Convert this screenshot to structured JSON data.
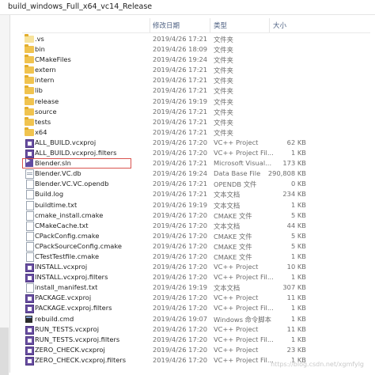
{
  "window": {
    "path": "build_windows_Full_x64_vc14_Release"
  },
  "columns": {
    "name": "",
    "date": "修改日期",
    "type": "类型",
    "size": "大小"
  },
  "files": [
    {
      "name": ".vs",
      "date": "2019/4/26 17:21",
      "type": "文件夹",
      "size": "",
      "icon": "folder-light-icon"
    },
    {
      "name": "bin",
      "date": "2019/4/26 18:09",
      "type": "文件夹",
      "size": "",
      "icon": "folder-icon"
    },
    {
      "name": "CMakeFiles",
      "date": "2019/4/26 19:24",
      "type": "文件夹",
      "size": "",
      "icon": "folder-icon"
    },
    {
      "name": "extern",
      "date": "2019/4/26 17:21",
      "type": "文件夹",
      "size": "",
      "icon": "folder-icon"
    },
    {
      "name": "intern",
      "date": "2019/4/26 17:21",
      "type": "文件夹",
      "size": "",
      "icon": "folder-icon"
    },
    {
      "name": "lib",
      "date": "2019/4/26 17:21",
      "type": "文件夹",
      "size": "",
      "icon": "folder-icon"
    },
    {
      "name": "release",
      "date": "2019/4/26 19:19",
      "type": "文件夹",
      "size": "",
      "icon": "folder-icon"
    },
    {
      "name": "source",
      "date": "2019/4/26 17:21",
      "type": "文件夹",
      "size": "",
      "icon": "folder-icon"
    },
    {
      "name": "tests",
      "date": "2019/4/26 17:21",
      "type": "文件夹",
      "size": "",
      "icon": "folder-icon"
    },
    {
      "name": "x64",
      "date": "2019/4/26 17:21",
      "type": "文件夹",
      "size": "",
      "icon": "folder-icon"
    },
    {
      "name": "ALL_BUILD.vcxproj",
      "date": "2019/4/26 17:20",
      "type": "VC++ Project",
      "size": "62 KB",
      "icon": "vcxproj-icon"
    },
    {
      "name": "ALL_BUILD.vcxproj.filters",
      "date": "2019/4/26 17:20",
      "type": "VC++ Project Fil...",
      "size": "1 KB",
      "icon": "vcxproj-icon"
    },
    {
      "name": "Blender.sln",
      "date": "2019/4/26 17:21",
      "type": "Microsoft Visual...",
      "size": "173 KB",
      "icon": "sln-icon",
      "selected": true
    },
    {
      "name": "Blender.VC.db",
      "date": "2019/4/26 19:24",
      "type": "Data Base File",
      "size": "290,808 KB",
      "icon": "db-icon"
    },
    {
      "name": "Blender.VC.VC.opendb",
      "date": "2019/4/26 17:21",
      "type": "OPENDB 文件",
      "size": "0 KB",
      "icon": "file-icon"
    },
    {
      "name": "Build.log",
      "date": "2019/4/26 17:21",
      "type": "文本文档",
      "size": "234 KB",
      "icon": "file-icon"
    },
    {
      "name": "buildtime.txt",
      "date": "2019/4/26 19:19",
      "type": "文本文档",
      "size": "1 KB",
      "icon": "file-icon"
    },
    {
      "name": "cmake_install.cmake",
      "date": "2019/4/26 17:20",
      "type": "CMAKE 文件",
      "size": "5 KB",
      "icon": "file-icon"
    },
    {
      "name": "CMakeCache.txt",
      "date": "2019/4/26 17:20",
      "type": "文本文档",
      "size": "44 KB",
      "icon": "file-icon"
    },
    {
      "name": "CPackConfig.cmake",
      "date": "2019/4/26 17:20",
      "type": "CMAKE 文件",
      "size": "5 KB",
      "icon": "file-icon"
    },
    {
      "name": "CPackSourceConfig.cmake",
      "date": "2019/4/26 17:20",
      "type": "CMAKE 文件",
      "size": "5 KB",
      "icon": "file-icon"
    },
    {
      "name": "CTestTestfile.cmake",
      "date": "2019/4/26 17:20",
      "type": "CMAKE 文件",
      "size": "1 KB",
      "icon": "file-icon"
    },
    {
      "name": "INSTALL.vcxproj",
      "date": "2019/4/26 17:20",
      "type": "VC++ Project",
      "size": "10 KB",
      "icon": "vcxproj-icon"
    },
    {
      "name": "INSTALL.vcxproj.filters",
      "date": "2019/4/26 17:20",
      "type": "VC++ Project Fil...",
      "size": "1 KB",
      "icon": "vcxproj-icon"
    },
    {
      "name": "install_manifest.txt",
      "date": "2019/4/26 19:19",
      "type": "文本文档",
      "size": "307 KB",
      "icon": "file-icon"
    },
    {
      "name": "PACKAGE.vcxproj",
      "date": "2019/4/26 17:20",
      "type": "VC++ Project",
      "size": "11 KB",
      "icon": "vcxproj-icon"
    },
    {
      "name": "PACKAGE.vcxproj.filters",
      "date": "2019/4/26 17:20",
      "type": "VC++ Project Fil...",
      "size": "1 KB",
      "icon": "vcxproj-icon"
    },
    {
      "name": "rebuild.cmd",
      "date": "2019/4/26 19:07",
      "type": "Windows 命令脚本",
      "size": "1 KB",
      "icon": "cmd-icon"
    },
    {
      "name": "RUN_TESTS.vcxproj",
      "date": "2019/4/26 17:20",
      "type": "VC++ Project",
      "size": "11 KB",
      "icon": "vcxproj-icon"
    },
    {
      "name": "RUN_TESTS.vcxproj.filters",
      "date": "2019/4/26 17:20",
      "type": "VC++ Project Fil...",
      "size": "1 KB",
      "icon": "vcxproj-icon"
    },
    {
      "name": "ZERO_CHECK.vcxproj",
      "date": "2019/4/26 17:20",
      "type": "VC++ Project",
      "size": "23 KB",
      "icon": "vcxproj-icon"
    },
    {
      "name": "ZERO_CHECK.vcxproj.filters",
      "date": "2019/4/26 17:20",
      "type": "VC++ Project Fil...",
      "size": "1 KB",
      "icon": "vcxproj-icon"
    }
  ],
  "watermark": "https://blog.csdn.net/xgmfylg"
}
